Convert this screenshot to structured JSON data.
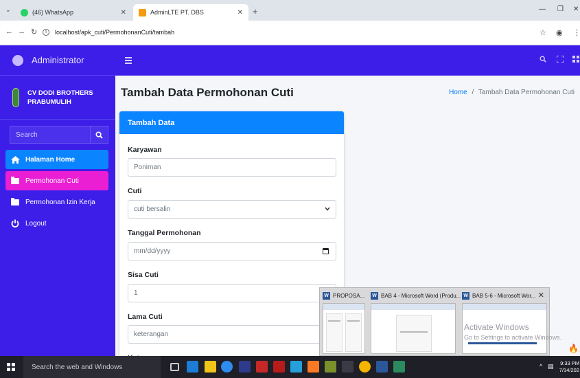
{
  "browser": {
    "tabs": [
      {
        "label": "(46) WhatsApp",
        "active": false
      },
      {
        "label": "AdminLTE PT. DBS",
        "active": true
      }
    ],
    "url": "localhost/apk_cuti/PermohonanCuti/tambah"
  },
  "app": {
    "brand": "Administrator",
    "company_line1": "CV DODI BROTHERS",
    "company_line2": "PRABUMULIH"
  },
  "sidebar": {
    "search_placeholder": "Search",
    "items": [
      {
        "label": "Halaman Home",
        "state": "home"
      },
      {
        "label": "Permohonan Cuti",
        "state": "active"
      },
      {
        "label": "Permohonan Izin Kerja",
        "state": "normal"
      },
      {
        "label": "Logout",
        "state": "normal"
      }
    ]
  },
  "page": {
    "title": "Tambah Data Permohonan Cuti",
    "breadcrumb_home": "Home",
    "breadcrumb_separator": "/",
    "breadcrumb_current": "Tambah Data Permohonan Cuti"
  },
  "card": {
    "header": "Tambah Data",
    "fields": [
      {
        "label": "Karyawan",
        "value": "Poniman",
        "type": "text"
      },
      {
        "label": "Cuti",
        "value": "cuti bersalin",
        "type": "select"
      },
      {
        "label": "Tanggal Permohonan",
        "value": "mm/dd/yyyy",
        "type": "date"
      },
      {
        "label": "Sisa Cuti",
        "value": "1",
        "type": "number"
      },
      {
        "label": "Lama Cuti",
        "value": "keterangan",
        "type": "text"
      },
      {
        "label": "Keterangan",
        "value": "",
        "type": "text"
      }
    ]
  },
  "taskbar_preview": {
    "windows": [
      {
        "title": "PROPOSA..."
      },
      {
        "title": "BAB 4 - Microsoft Word (Produ..."
      },
      {
        "title": "BAB 5-6 - Microsoft Wor..."
      }
    ],
    "watermark_title": "Activate Windows",
    "watermark_sub": "Go to Settings to activate Windows."
  },
  "taskbar": {
    "search_placeholder": "Search the web and Windows",
    "time": "9:33 PM",
    "date": "7/14/202"
  },
  "colors": {
    "sidebar": "#3c1ee8",
    "primary": "#0a84ff",
    "active_nav": "#ea1fd3"
  }
}
